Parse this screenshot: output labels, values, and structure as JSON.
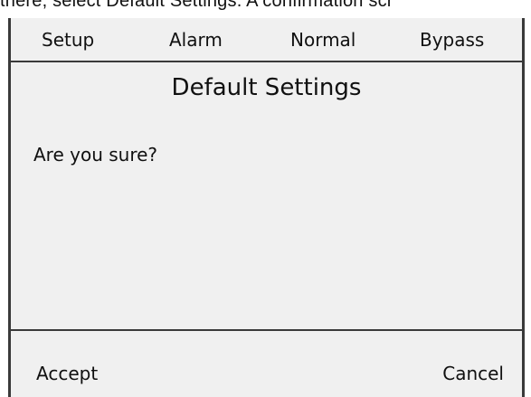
{
  "caption": "there, select Default Settings. A confirmation scr",
  "menu": {
    "setup": "Setup",
    "alarm": "Alarm",
    "normal": "Normal",
    "bypass": "Bypass"
  },
  "dialog": {
    "title": "Default Settings",
    "question": "Are you sure?"
  },
  "softkeys": {
    "accept": "Accept",
    "cancel": "Cancel"
  }
}
